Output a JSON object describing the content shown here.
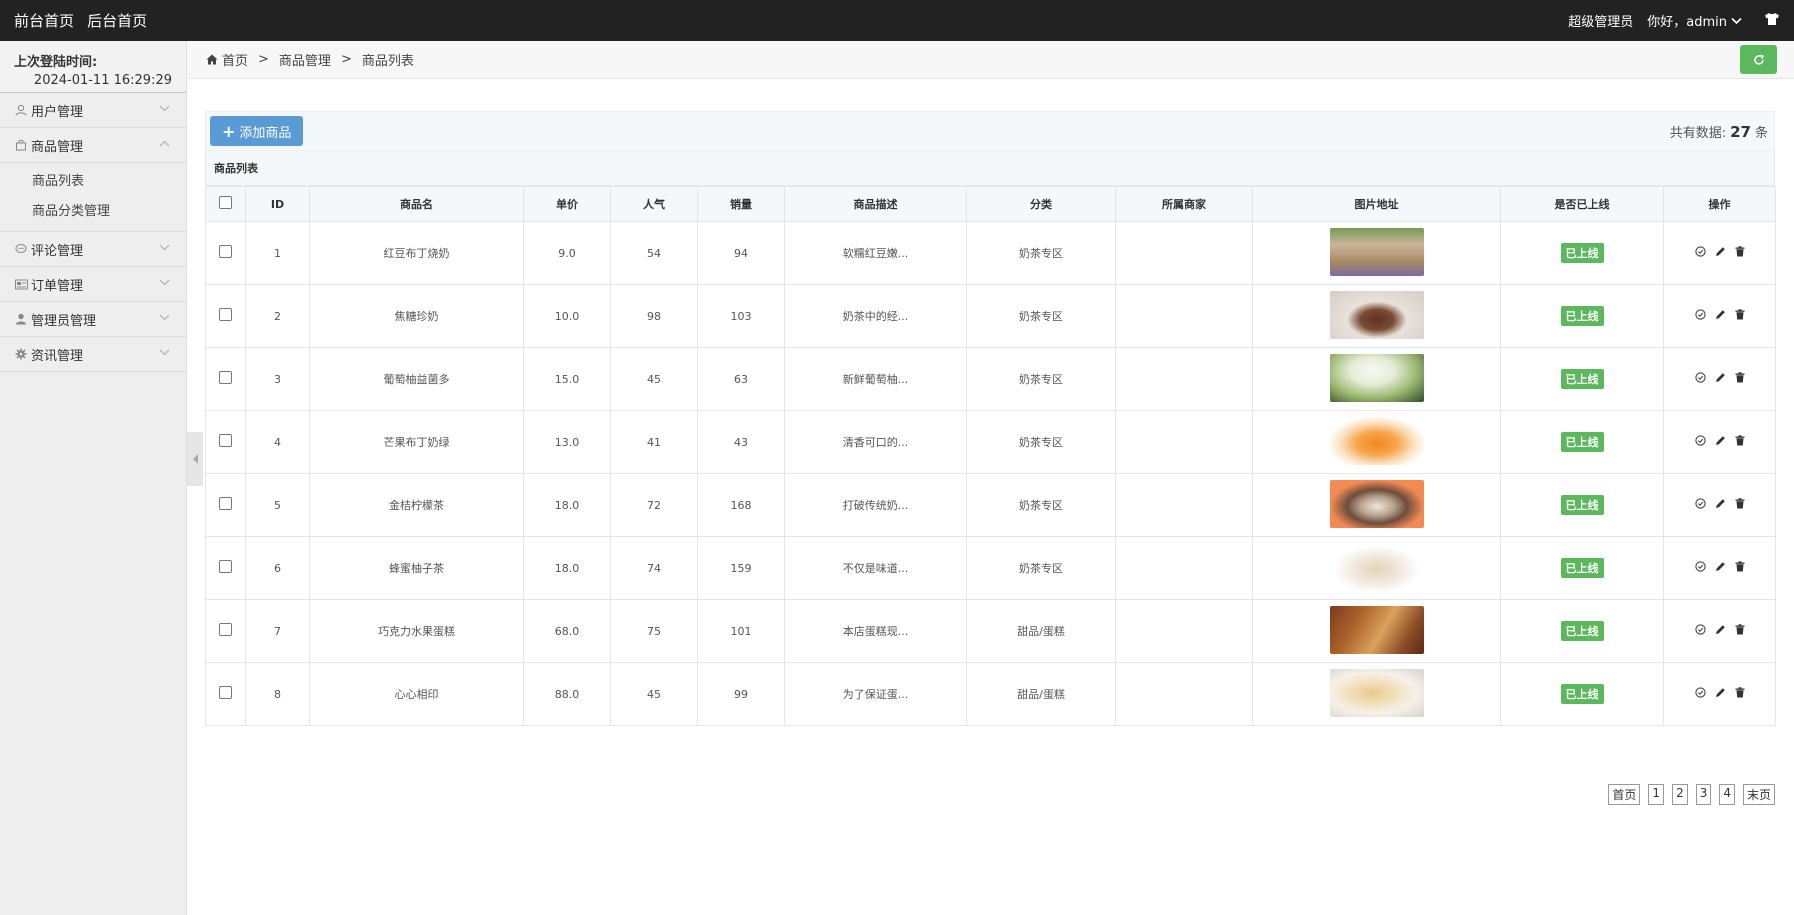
{
  "topbar": {
    "front_home": "前台首页",
    "back_home": "后台首页",
    "role": "超级管理员",
    "greeting": "你好，admin"
  },
  "sidebar": {
    "last_login_label": "上次登陆时间:",
    "last_login_time": "2024-01-11 16:29:29",
    "menus": [
      {
        "label": "用户管理",
        "icon": "user-icon"
      },
      {
        "label": "商品管理",
        "icon": "bag-icon",
        "expanded": true
      },
      {
        "label": "评论管理",
        "icon": "comment-icon"
      },
      {
        "label": "订单管理",
        "icon": "card-icon"
      },
      {
        "label": "管理员管理",
        "icon": "admin-icon"
      },
      {
        "label": "资讯管理",
        "icon": "gear-icon"
      }
    ],
    "submenu": [
      "商品列表",
      "商品分类管理"
    ]
  },
  "breadcrumb": {
    "home": "首页",
    "level1": "商品管理",
    "level2": "商品列表",
    "sep": ">"
  },
  "toolbar": {
    "add_label": "添加商品",
    "total_prefix": "共有数据:",
    "total_count": "27",
    "total_suffix": "条"
  },
  "table": {
    "caption": "商品列表",
    "headers": [
      "ID",
      "商品名",
      "单价",
      "人气",
      "销量",
      "商品描述",
      "分类",
      "所属商家",
      "图片地址",
      "是否已上线",
      "操作"
    ],
    "rows": [
      {
        "id": "1",
        "name": "红豆布丁烧奶",
        "price": "9.0",
        "pop": "54",
        "sales": "94",
        "desc": "软糯红豆嫩...",
        "cat": "奶茶专区",
        "merchant": "",
        "status": "已上线",
        "img": "iced-tea-cup"
      },
      {
        "id": "2",
        "name": "焦糖珍奶",
        "price": "10.0",
        "pop": "98",
        "sales": "103",
        "desc": "奶茶中的经...",
        "cat": "奶茶专区",
        "merchant": "",
        "status": "已上线",
        "img": "chocolate-cup"
      },
      {
        "id": "3",
        "name": "葡萄柚益菌多",
        "price": "15.0",
        "pop": "45",
        "sales": "63",
        "desc": "新鲜葡萄柚...",
        "cat": "奶茶专区",
        "merchant": "",
        "status": "已上线",
        "img": "matcha-cream"
      },
      {
        "id": "4",
        "name": "芒果布丁奶绿",
        "price": "13.0",
        "pop": "41",
        "sales": "43",
        "desc": "清香可口的...",
        "cat": "奶茶专区",
        "merchant": "",
        "status": "已上线",
        "img": "orange-drink"
      },
      {
        "id": "5",
        "name": "金桔柠檬茶",
        "price": "18.0",
        "pop": "72",
        "sales": "168",
        "desc": "打破传统奶...",
        "cat": "奶茶专区",
        "merchant": "",
        "status": "已上线",
        "img": "milk-tea-orange-bg"
      },
      {
        "id": "6",
        "name": "蜂蜜柚子茶",
        "price": "18.0",
        "pop": "74",
        "sales": "159",
        "desc": "不仅是味道...",
        "cat": "奶茶专区",
        "merchant": "",
        "status": "已上线",
        "img": "milk-tea-glass"
      },
      {
        "id": "7",
        "name": "巧克力水果蛋糕",
        "price": "68.0",
        "pop": "75",
        "sales": "101",
        "desc": "本店蛋糕现...",
        "cat": "甜品/蛋糕",
        "merchant": "",
        "status": "已上线",
        "img": "pizza-cake"
      },
      {
        "id": "8",
        "name": "心心相印",
        "price": "88.0",
        "pop": "45",
        "sales": "99",
        "desc": "为了保证蛋...",
        "cat": "甜品/蛋糕",
        "merchant": "",
        "status": "已上线",
        "img": "crepe-plate"
      }
    ]
  },
  "pager": {
    "first": "首页",
    "pages": [
      "1",
      "2",
      "3",
      "4"
    ],
    "last": "末页"
  },
  "colors": {
    "topbar": "#222222",
    "primary": "#5b9bd5",
    "success": "#5cb85c"
  }
}
